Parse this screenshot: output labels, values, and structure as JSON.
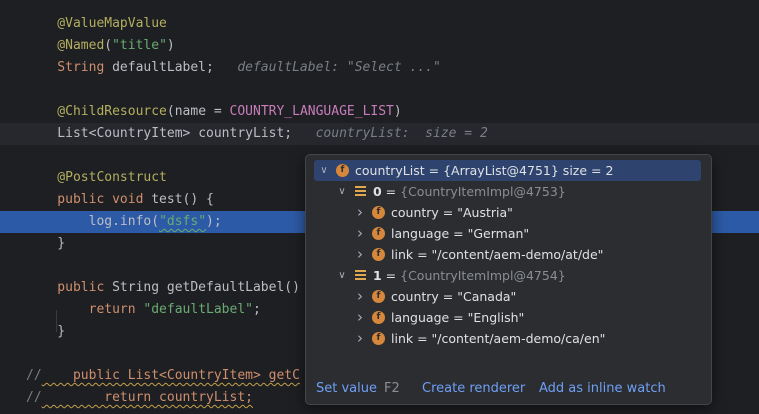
{
  "editor": {
    "lines": [
      {
        "t": 24,
        "parts": [
          [
            "ann",
            "    @ValueMapValue"
          ]
        ]
      },
      {
        "t": 46,
        "parts": [
          [
            "ann",
            "    @Named"
          ],
          [
            "plain",
            "("
          ],
          [
            "str",
            "\"title\""
          ],
          [
            "plain",
            ")"
          ]
        ]
      },
      {
        "t": 68,
        "parts": [
          [
            "kw",
            "    String "
          ],
          [
            "plain",
            "defaultLabel;"
          ],
          [
            "inlay",
            "   defaultLabel: \"Select ...\""
          ]
        ]
      },
      {
        "t": 112,
        "parts": [
          [
            "ann",
            "    @ChildResource"
          ],
          [
            "plain",
            "(name = "
          ],
          [
            "const",
            "COUNTRY_LANGUAGE_LIST"
          ],
          [
            "plain",
            ")"
          ]
        ]
      },
      {
        "t": 134,
        "parts": [
          [
            "plain",
            "    List<"
          ],
          [
            "kw2",
            "CountryItem"
          ],
          [
            "plain",
            "> countryList;"
          ],
          [
            "inlay",
            "   countryList:  size = 2"
          ]
        ],
        "cls": "hl-caret"
      },
      {
        "t": 178,
        "parts": [
          [
            "ann",
            "    @PostConstruct"
          ]
        ]
      },
      {
        "t": 200,
        "parts": [
          [
            "kw",
            "    public void "
          ],
          [
            "plain",
            "test() {"
          ]
        ]
      },
      {
        "t": 222,
        "parts": [
          [
            "plain",
            "        log.info("
          ],
          [
            "strsq",
            "\"dsfs\""
          ],
          [
            "plain",
            ");"
          ]
        ],
        "cls": "hl-exec"
      },
      {
        "t": 244,
        "parts": [
          [
            "plain",
            "    }"
          ]
        ]
      },
      {
        "t": 288,
        "parts": [
          [
            "kw",
            "    public "
          ],
          [
            "plain",
            "String getDefaultLabel()"
          ]
        ]
      },
      {
        "t": 310,
        "parts": [
          [
            "kw",
            "        return "
          ],
          [
            "str",
            "\"defaultLabel\""
          ],
          [
            "plain",
            ";"
          ]
        ]
      },
      {
        "t": 332,
        "parts": [
          [
            "plain",
            "    }"
          ]
        ]
      },
      {
        "t": 376,
        "parts": [
          [
            "cmt",
            "//"
          ],
          [
            "warn",
            "    public List<CountryItem> getC"
          ]
        ]
      },
      {
        "t": 398,
        "parts": [
          [
            "cmt",
            "//"
          ],
          [
            "warn",
            "        return countryList;"
          ]
        ]
      }
    ]
  },
  "popup": {
    "rows": [
      {
        "indent": 0,
        "expanded": true,
        "icon": "field",
        "name": "countryList",
        "eq": " = ",
        "value": "{ArrayList@4751}",
        "extra": "  size = 2",
        "selected": true
      },
      {
        "indent": 1,
        "expanded": true,
        "icon": "list",
        "name": "0",
        "eq": " = ",
        "value": "{CountryItemImpl@4753}",
        "dim": true
      },
      {
        "indent": 2,
        "expanded": false,
        "icon": "field",
        "name": "country",
        "eq": " = ",
        "value": "\"Austria\""
      },
      {
        "indent": 2,
        "expanded": false,
        "icon": "field",
        "name": "language",
        "eq": " = ",
        "value": "\"German\""
      },
      {
        "indent": 2,
        "expanded": false,
        "icon": "field",
        "name": "link",
        "eq": " = ",
        "value": "\"/content/aem-demo/at/de\""
      },
      {
        "indent": 1,
        "expanded": true,
        "icon": "list",
        "name": "1",
        "eq": " = ",
        "value": "{CountryItemImpl@4754}",
        "dim": true
      },
      {
        "indent": 2,
        "expanded": false,
        "icon": "field",
        "name": "country",
        "eq": " = ",
        "value": "\"Canada\""
      },
      {
        "indent": 2,
        "expanded": false,
        "icon": "field",
        "name": "language",
        "eq": " = ",
        "value": "\"English\""
      },
      {
        "indent": 2,
        "expanded": false,
        "icon": "field",
        "name": "link",
        "eq": " = ",
        "value": "\"/content/aem-demo/ca/en\""
      }
    ],
    "footer": {
      "set_value": "Set value",
      "set_value_shortcut": "F2",
      "create_renderer": "Create renderer",
      "add_inline_watch": "Add as inline watch"
    }
  },
  "colors": {
    "editor_bg": "#1e1f22",
    "exec_line": "#2d5aa6",
    "popup_bg": "#2b2d30",
    "selection": "#2e436e",
    "link": "#6f9ff5",
    "field_badge": "#d6873b"
  }
}
